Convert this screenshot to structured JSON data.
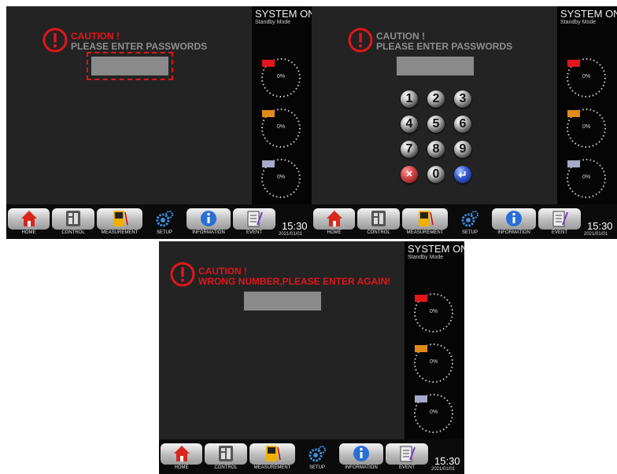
{
  "status": {
    "title": "SYSTEM ON",
    "mode": "Standby Mode"
  },
  "gauges": [
    {
      "badge": "L1",
      "badge_color": "#e0161c",
      "value_label": "0%",
      "value_pct": 0
    },
    {
      "badge": "L2",
      "badge_color": "#e08a1a",
      "value_label": "0%",
      "value_pct": 0
    },
    {
      "badge": "L3",
      "badge_color": "#a8a8c8",
      "value_label": "0%",
      "value_pct": 0
    }
  ],
  "caution": {
    "title": "CAUTION !",
    "prompt": "PLEASE ENTER PASSWORDS",
    "error": "WRONG NUMBER,PLEASE ENTER AGAIN!"
  },
  "keypad": {
    "keys": [
      "1",
      "2",
      "3",
      "4",
      "5",
      "6",
      "7",
      "8",
      "9"
    ],
    "delete_label": "✕",
    "zero_label": "0",
    "enter_label": "↵"
  },
  "nav": {
    "home": "HOME",
    "control": "CONTROL",
    "measurement": "MEASUREMENT",
    "setup": "SETUP",
    "information": "INFORMATION",
    "event": "EVENT"
  },
  "clock": {
    "time": "15:30",
    "date": "2021/01/01"
  },
  "colors": {
    "caution_grey": "#8e8e8e",
    "caution_red": "#e0161c",
    "panel_bg": "#232323"
  }
}
